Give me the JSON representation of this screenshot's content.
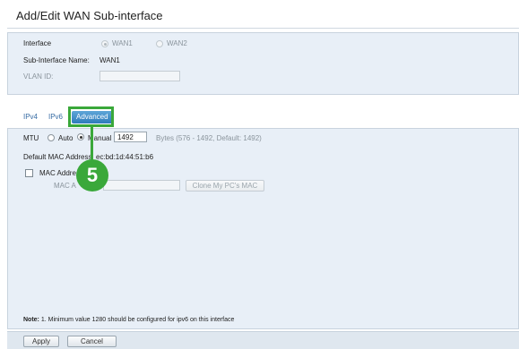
{
  "page": {
    "title": "Add/Edit WAN Sub-interface"
  },
  "interface_section": {
    "interface_label": "Interface",
    "options": [
      "WAN1",
      "WAN2"
    ],
    "selected": "WAN1",
    "sub_interface_name_label": "Sub-Interface Name:",
    "sub_interface_name_value": "WAN1",
    "vlan_id_label": "VLAN ID:",
    "vlan_id_value": ""
  },
  "tabs": [
    {
      "label": "IPv4",
      "active": false
    },
    {
      "label": "IPv6",
      "active": false
    },
    {
      "label": "Advanced",
      "active": true
    }
  ],
  "advanced": {
    "mtu_label": "MTU",
    "mtu_auto_label": "Auto",
    "mtu_manual_label": "Manual",
    "mtu_mode": "Manual",
    "mtu_value": "1492",
    "mtu_hint": "Bytes (576 - 1492, Default: 1492)",
    "default_mac_label": "Default MAC Address:",
    "default_mac_value": "ec:bd:1d:44:51:b6",
    "mac_clone_label": "MAC Addre",
    "mac_clone_checked": false,
    "mac_address_label": "MAC A",
    "mac_address_value": "",
    "clone_button_label": "Clone My PC's MAC"
  },
  "note": {
    "prefix": "Note:",
    "text": " 1. Minimum value 1280 should be configured for ipv6 on this interface"
  },
  "footer": {
    "apply_label": "Apply",
    "cancel_label": "Cancel"
  },
  "annotation": {
    "step_number": "5",
    "color": "#3aa83a"
  },
  "colors": {
    "panel_background": "#e8eff7",
    "active_tab": "#2e7bbb",
    "link_tab": "#3a6ea5"
  }
}
